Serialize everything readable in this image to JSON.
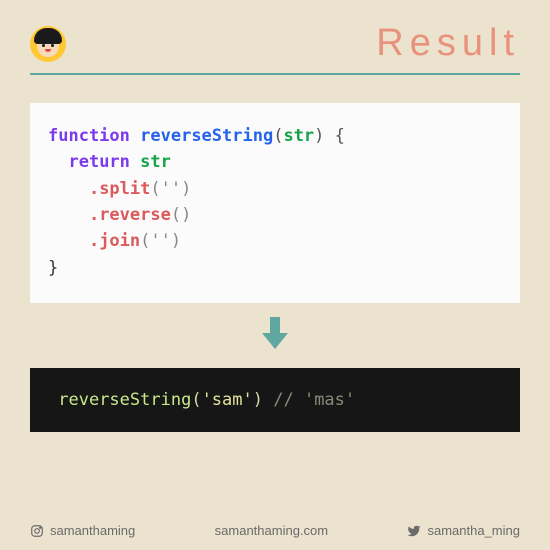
{
  "header": {
    "title": "Result"
  },
  "code_light": {
    "keyword_function": "function",
    "fn_name": "reverseString",
    "param_open": "(",
    "param": "str",
    "param_close_brace": ") {",
    "keyword_return": "return",
    "return_var": "str",
    "method_split": ".split",
    "split_args": "('')",
    "method_reverse": ".reverse",
    "reverse_args": "()",
    "method_join": ".join",
    "join_args": "('')",
    "close_brace": "}"
  },
  "code_dark": {
    "call_fn": "reverseString",
    "call_open": "(",
    "call_arg": "'sam'",
    "call_close": ")",
    "comment": "// 'mas'"
  },
  "footer": {
    "instagram": "samanthaming",
    "website": "samanthaming.com",
    "twitter": "samantha_ming"
  }
}
